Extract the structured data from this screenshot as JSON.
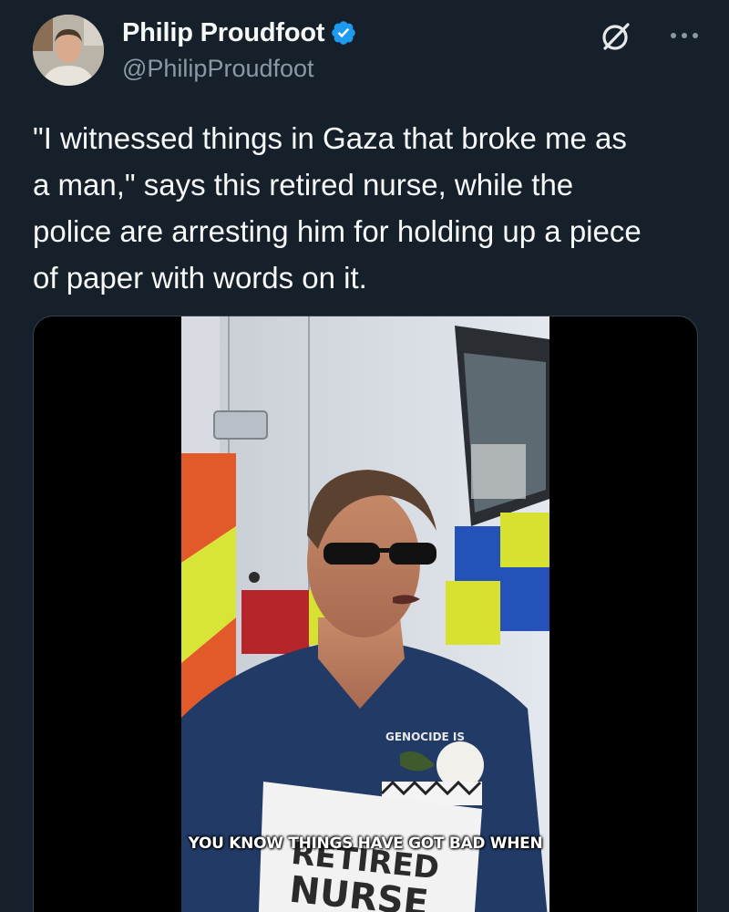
{
  "author": {
    "display_name": "Philip Proudfoot",
    "handle": "@PhilipProudfoot",
    "verified": true
  },
  "icons": {
    "verified": "verified-badge-icon",
    "grok": "grok-icon",
    "more": "more-options-icon"
  },
  "tweet": {
    "text": "\"I witnessed things in Gaza that broke me as\na man,\" says this retired nurse, while the\npolice are arresting him for holding up a piece\nof paper with words on it."
  },
  "media": {
    "type": "video",
    "caption": "YOU KNOW THINGS HAVE GOT BAD WHEN",
    "sign_text_top": "RETIRED",
    "sign_text_bottom": "NURSE",
    "shirt_text": "GENOCIDE IS"
  },
  "colors": {
    "background": "#15202b",
    "text": "#f7f9f9",
    "secondary_text": "#8b98a5",
    "verified_blue": "#1d9bf0",
    "media_border": "#38444d"
  }
}
